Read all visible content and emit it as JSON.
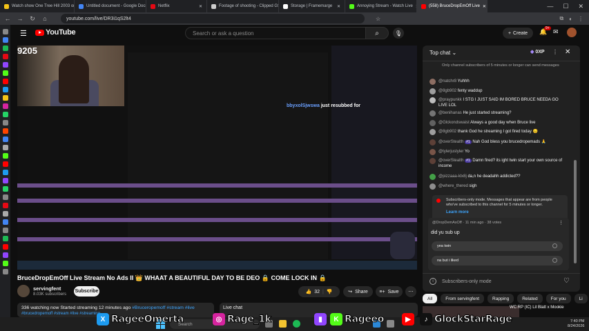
{
  "browser": {
    "tabs": [
      {
        "label": "Watch show One Tree Hill 2003 on",
        "color": "#f5c518"
      },
      {
        "label": "Untitled document - Google Docs",
        "color": "#4285f4"
      },
      {
        "label": "Netflix",
        "color": "#e50914"
      },
      {
        "label": "Footage of shooting - Clipped GS",
        "color": "#cccccc"
      },
      {
        "label": "Storage | Framemarge",
        "color": "#ffffff"
      },
      {
        "label": "Annoying Stream - Watch Live",
        "color": "#53fc18"
      },
      {
        "label": "(558) BruceDropEmOff Live",
        "color": "#ff0000"
      }
    ],
    "url": "youtube.com/live/DR3i1qS2lt4"
  },
  "youtube": {
    "logo": "YouTube",
    "search_placeholder": "Search or ask a question",
    "create_label": "Create",
    "notif_count": "9+"
  },
  "video": {
    "viewer_count": "9205",
    "overlay_user": "bbyxolSjwswa",
    "overlay_text": "just resubbed for"
  },
  "stream": {
    "title": "BruceDropEmOff Live Stream No Ads II 👑 WHAAT A BEAUTIFUL DAY TO BE DEO 🔒 COME LOCK IN 🔒",
    "channel": "servingfent",
    "subscribers": "8.03K subscribers",
    "subscribe_label": "Subscribe",
    "likes": "32",
    "share_label": "Share",
    "save_label": "Save",
    "watching": "336 watching now",
    "started": "Started streaming 12 minutes ago",
    "tags": "#Bruceropemoff #stream #live",
    "tags2": "#brucedropemoff #stream #live #streaming",
    "live_chat_label": "Live chat"
  },
  "chat": {
    "header": "Top chat",
    "xp": "0XP",
    "mode_note": "Only channel subscribers of 5 minutes or longer can send messages",
    "messages": [
      {
        "user": "@natchr8",
        "text": "Yuhhh",
        "color": "#8d6e63"
      },
      {
        "user": "@8gb902",
        "text": "fenty waddup",
        "color": "#9e9e9e"
      },
      {
        "user": "@praypunkk",
        "text": "I STG I JUST SAID IM BORED BRUCE NEEDA GO LIVE LOL",
        "color": "#bdbdbd"
      },
      {
        "user": "@benihanas",
        "text": "He just started streaming?",
        "color": "#757575"
      },
      {
        "user": "@Glckondswaist",
        "text": "Always a good day when Bruce live",
        "color": "#616161"
      },
      {
        "user": "@8gb902",
        "text": "thank God he streaming I got fired today 😔",
        "color": "#9e9e9e"
      },
      {
        "user": "@overStealth",
        "badge": "#1",
        "text": "Nah God bless you brucedropemads 🙏",
        "color": "#5d4037"
      },
      {
        "user": "@tylerjustyler",
        "text": "Yo",
        "color": "#795548"
      },
      {
        "user": "@overStealth",
        "badge": "#1",
        "text": "Damn fired? its ight twin start your own source of income",
        "color": "#5d4037"
      },
      {
        "user": "@pizzaaa-klx8j",
        "text": "da,n he deadahh addicted??",
        "color": "#43a047"
      },
      {
        "user": "@where_thered",
        "text": "sigh",
        "color": "#8d8d8d"
      }
    ],
    "submode_text": "Subscribers-only mode. Messages that appear are from people who've subscribed to this channel for 5 minutes or longer.",
    "learn_more": "Learn more",
    "poll_header": "@DropDemAsOff · 11 min ago · 38 votes",
    "poll_question": "did yu sub up",
    "poll_options": [
      "yea twin",
      "na but i liked"
    ],
    "input_placeholder": "Subscribers-only mode"
  },
  "chips": [
    "All",
    "From servingfent",
    "Rapping",
    "Related",
    "For you",
    "Li"
  ],
  "recommended": {
    "title": "WC:RP (IC) Lil Blatt x Mookie"
  },
  "taskbar": {
    "search": "Search",
    "time": "7:40 PM",
    "date": "8/24/2026"
  },
  "socials": [
    {
      "icon": "X",
      "handle": "RageeOmerta",
      "bg": "#1d9bf0"
    },
    {
      "icon": "◎",
      "handle": "Rage_1k",
      "bg": "#d6249f"
    },
    {
      "icon": "▮",
      "handle": "",
      "bg": "#9146ff"
    },
    {
      "icon": "K",
      "handle": "Rageeo",
      "bg": "#53fc18"
    },
    {
      "icon": "▶",
      "handle": "",
      "bg": "#ff0000"
    },
    {
      "icon": "♪",
      "handle": "GlockStarRage",
      "bg": "#111111"
    }
  ]
}
